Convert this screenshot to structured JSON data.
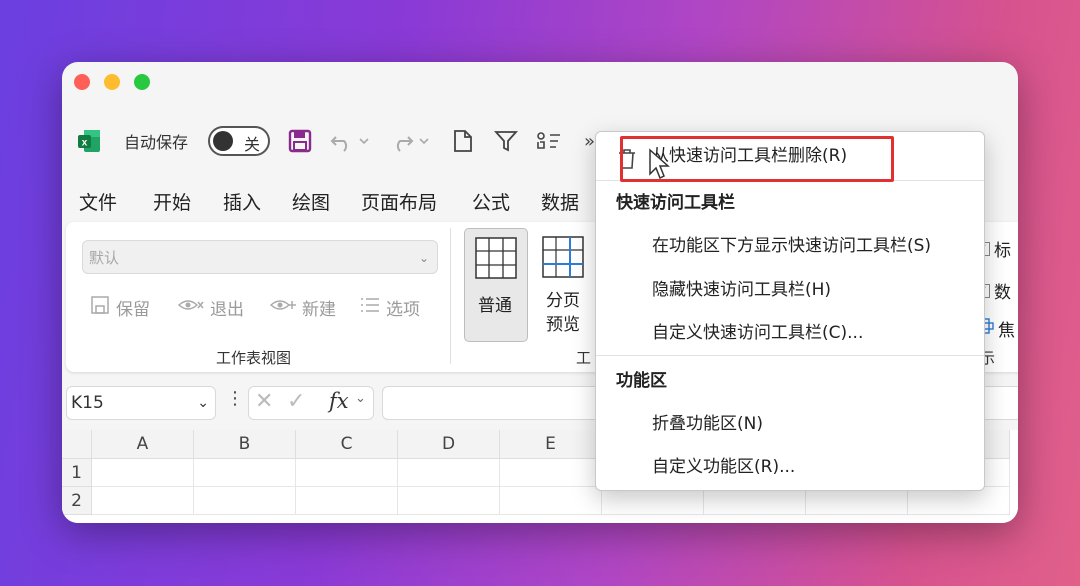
{
  "colors": {
    "accent": "#1e7145",
    "highlight": "#e03030",
    "save_icon": "#8a2a8f"
  },
  "qat": {
    "autosave_label": "自动保存",
    "autosave_toggle": "关"
  },
  "menubar": [
    "文件",
    "开始",
    "插入",
    "绘图",
    "页面布局",
    "公式",
    "数据"
  ],
  "ribbon": {
    "view_combo_placeholder": "默认",
    "keep": "保留",
    "exit": "退出",
    "new": "新建",
    "options": "选项",
    "group_label": "工作表视图",
    "normal_view": "普通",
    "page_break_1": "分页",
    "page_break_2": "预览",
    "partial_group_label": "工",
    "right_1": "标",
    "right_2": "数",
    "right_3": "焦",
    "right_4": "示"
  },
  "formula_bar": {
    "name_box": "K15",
    "fx": "fx"
  },
  "grid": {
    "columns": [
      "A",
      "B",
      "C",
      "D",
      "E"
    ],
    "rows": [
      "1",
      "2"
    ]
  },
  "context_menu": {
    "remove_item": "从快速访问工具栏删除(R)",
    "section1": "快速访问工具栏",
    "show_below": "在功能区下方显示快速访问工具栏(S)",
    "hide": "隐藏快速访问工具栏(H)",
    "customize_qat": "自定义快速访问工具栏(C)...",
    "section2": "功能区",
    "collapse": "折叠功能区(N)",
    "customize_ribbon": "自定义功能区(R)..."
  }
}
